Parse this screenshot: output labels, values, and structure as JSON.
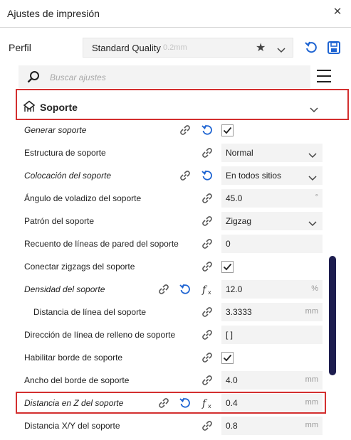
{
  "window": {
    "title": "Ajustes de impresión"
  },
  "profile": {
    "label": "Perfil",
    "name": "Standard Quality",
    "layer_height": "0.2mm"
  },
  "search": {
    "placeholder": "Buscar ajustes"
  },
  "category": {
    "label": "Soporte"
  },
  "settings": [
    {
      "label": "Generar soporte",
      "italic": true,
      "reset": true,
      "formula": false,
      "type": "checkbox",
      "checked": true
    },
    {
      "label": "Estructura de soporte",
      "italic": false,
      "reset": false,
      "formula": false,
      "type": "dropdown",
      "value": "Normal"
    },
    {
      "label": "Colocación del soporte",
      "italic": true,
      "reset": true,
      "formula": false,
      "type": "dropdown",
      "value": "En todos sitios"
    },
    {
      "label": "Ángulo de voladizo del soporte",
      "italic": false,
      "reset": false,
      "formula": false,
      "type": "number",
      "value": "45.0",
      "unit": "°"
    },
    {
      "label": "Patrón del soporte",
      "italic": false,
      "reset": false,
      "formula": false,
      "type": "dropdown",
      "value": "Zigzag"
    },
    {
      "label": "Recuento de líneas de pared del soporte",
      "italic": false,
      "reset": false,
      "formula": false,
      "type": "number",
      "value": "0",
      "unit": ""
    },
    {
      "label": "Conectar zigzags del soporte",
      "italic": false,
      "reset": false,
      "formula": false,
      "type": "checkbox",
      "checked": true
    },
    {
      "label": "Densidad del soporte",
      "italic": true,
      "reset": true,
      "formula": true,
      "type": "number",
      "value": "12.0",
      "unit": "%"
    },
    {
      "label": "Distancia de línea del soporte",
      "italic": false,
      "indent": true,
      "reset": false,
      "formula": false,
      "type": "number",
      "value": "3.3333",
      "unit": "mm"
    },
    {
      "label": "Dirección de línea de relleno de soporte",
      "italic": false,
      "reset": false,
      "formula": false,
      "type": "number",
      "value": "[ ]",
      "unit": ""
    },
    {
      "label": "Habilitar borde de soporte",
      "italic": false,
      "reset": false,
      "formula": false,
      "type": "checkbox",
      "checked": true
    },
    {
      "label": "Ancho del borde de soporte",
      "italic": false,
      "reset": false,
      "formula": false,
      "type": "number",
      "value": "4.0",
      "unit": "mm"
    },
    {
      "label": "Distancia en Z del soporte",
      "italic": true,
      "reset": true,
      "formula": true,
      "type": "number",
      "value": "0.4",
      "unit": "mm",
      "highlighted": true
    },
    {
      "label": "Distancia X/Y del soporte",
      "italic": false,
      "reset": false,
      "formula": false,
      "type": "number",
      "value": "0.8",
      "unit": "mm"
    }
  ],
  "colors": {
    "accent": "#1e64d2",
    "highlight": "#d32f2f",
    "field_bg": "#f3f3f3",
    "scrollbar": "#1d1d4f"
  },
  "icons": {
    "close": "close-icon",
    "star": "star-icon",
    "reset": "reset-icon",
    "save": "save-icon",
    "search": "search-icon",
    "menu": "menu-icon",
    "category": "support-icon",
    "link": "link-icon",
    "formula": "formula-icon",
    "check": "check-icon",
    "chevron": "chevron-down-icon"
  }
}
